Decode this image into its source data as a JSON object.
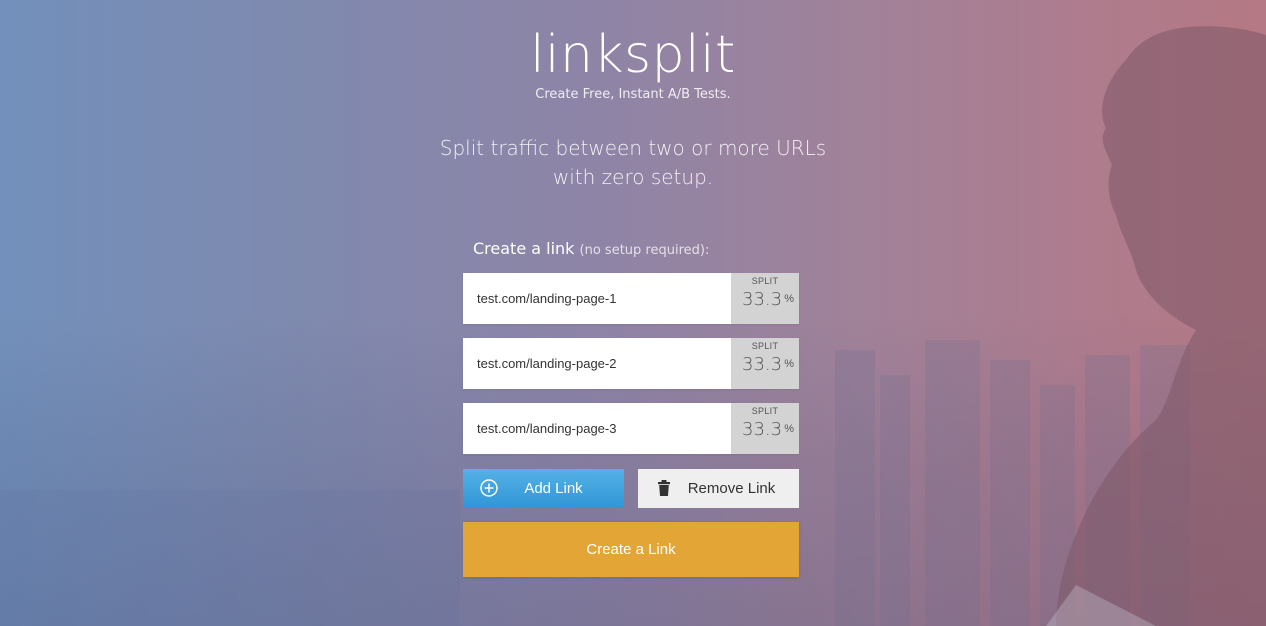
{
  "brand": {
    "logo": "linksplit",
    "tagline": "Create Free, Instant A/B Tests."
  },
  "headline": {
    "line1": "Split traffic between two or more URLs",
    "line2": "with zero setup."
  },
  "form": {
    "label": "Create a link",
    "label_sub": "(no setup required):",
    "split_label": "SPLIT",
    "percent_sign": "%",
    "links": [
      {
        "url": "test.com/landing-page-1",
        "split": "33.3"
      },
      {
        "url": "test.com/landing-page-2",
        "split": "33.3"
      },
      {
        "url": "test.com/landing-page-3",
        "split": "33.3"
      }
    ],
    "add_label": "Add Link",
    "add_icon": "plus-circle-icon",
    "remove_label": "Remove Link",
    "remove_icon": "trash-icon",
    "create_label": "Create a Link"
  },
  "colors": {
    "add_button": "#3a9fdc",
    "remove_button": "#efefef",
    "create_button": "#e3a535",
    "split_box": "#d3d3d3"
  }
}
